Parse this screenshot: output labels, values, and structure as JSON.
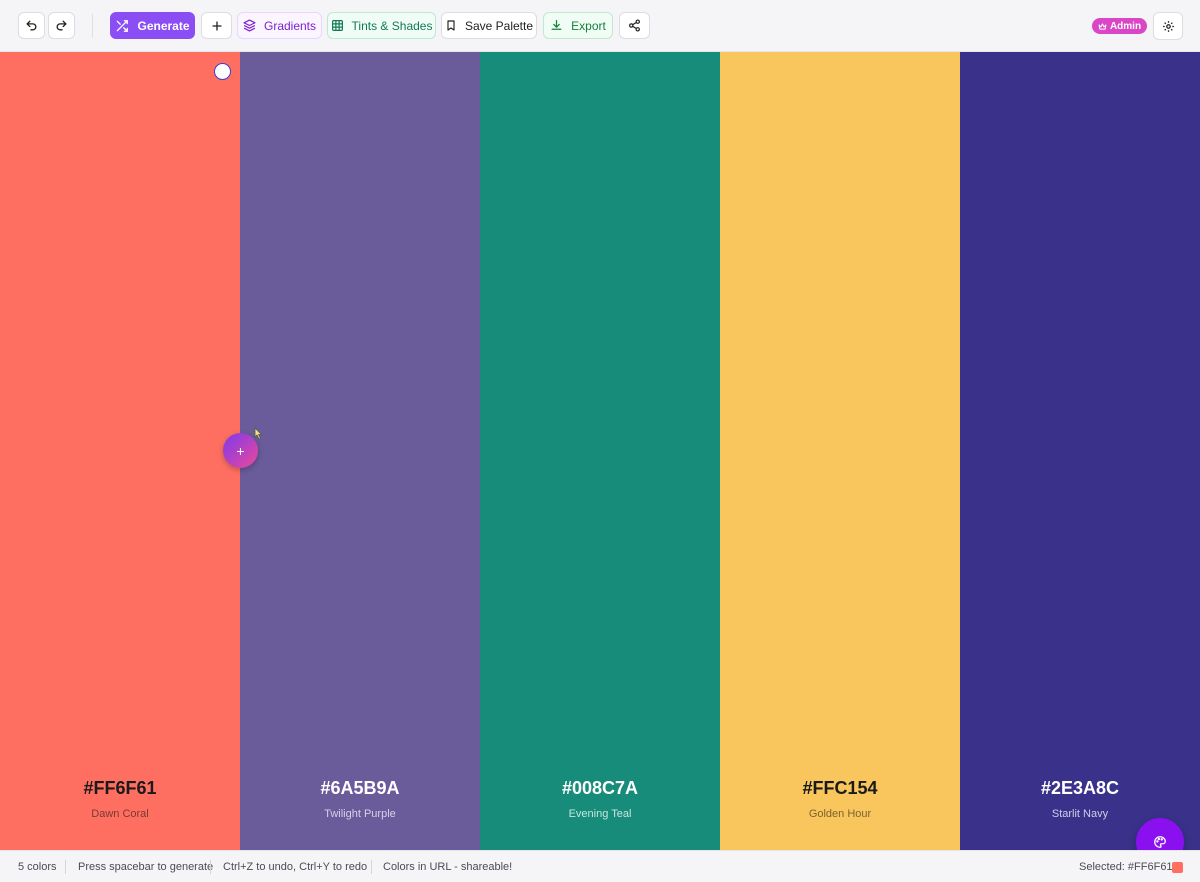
{
  "toolbar": {
    "generate_label": "Generate",
    "gradients_label": "Gradients",
    "tints_label": "Tints & Shades",
    "save_label": "Save Palette",
    "export_label": "Export",
    "admin_label": "Admin",
    "icons": [
      "undo-icon",
      "redo-icon",
      "shuffle-icon",
      "plus-icon",
      "layers-icon",
      "grid-icon",
      "bookmark-icon",
      "download-icon",
      "share-icon",
      "crown-icon",
      "gear-icon"
    ]
  },
  "palette": {
    "colors": [
      {
        "hex": "#FF6F61",
        "name": "Dawn Coral",
        "hex_color": "#FF6F61",
        "text_color": "#1a1a1a",
        "sub_color": "#7a3a32"
      },
      {
        "hex": "#6A5B9A",
        "name": "Twilight Purple",
        "hex_color": "#6A5B9A",
        "text_color": "#ffffff",
        "sub_color": "#d7d1ea"
      },
      {
        "hex": "#008C7A",
        "name": "Evening Teal",
        "hex_color": "#188C7A",
        "text_color": "#ffffff",
        "sub_color": "#c6e6e0"
      },
      {
        "hex": "#FFC154",
        "name": "Golden Hour",
        "hex_color": "#F8C65C",
        "text_color": "#1a1a1a",
        "sub_color": "#7c6330"
      },
      {
        "hex": "#2E3A8C",
        "name": "Starlit Navy",
        "hex_color": "#3A318A",
        "text_color": "#ffffff",
        "sub_color": "#cfcde6"
      }
    ],
    "insert_label": "+"
  },
  "status": {
    "count": "5 colors",
    "hint_generate": "Press spacebar to generate",
    "hint_undo": "Ctrl+Z to undo, Ctrl+Y to redo",
    "hint_url": "Colors in URL - shareable!",
    "selected": "Selected: #FF6F61",
    "selected_color": "#FF6F61"
  },
  "colors": {
    "accent": "#8B4EF5",
    "fab": "#8B10F0",
    "admin": "#D946C6"
  }
}
